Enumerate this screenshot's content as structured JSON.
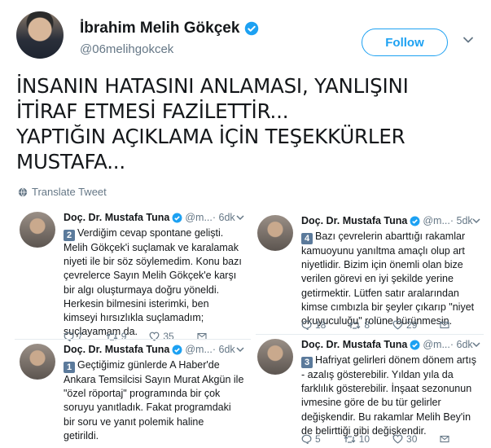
{
  "author": {
    "name": "İbrahim Melih Gökçek",
    "handle": "@06melihgokcek"
  },
  "follow_label": "Follow",
  "tweet_lines": [
    "İNSANIN HATASINI ANLAMASI, YANLIŞINI",
    "İTİRAF ETMESİ FAZİLETTİR...",
    "YAPTIĞIN AÇIKLAMA İÇİN TEŞEKKÜRLER",
    "MUSTAFA..."
  ],
  "translate_label": "Translate Tweet",
  "colors": {
    "accent": "#1da1f2",
    "secondary_text": "#657786",
    "divider": "#e6ecf0"
  },
  "embedded_tweets": [
    {
      "name": "Doç. Dr. Mustafa Tuna",
      "handle": "@m...",
      "time": "· 6dk",
      "badge": "2",
      "lines": [
        "Verdiğim cevap spontane gelişti.",
        "Melih Gökçek'i suçlamak ve karalamak",
        "niyeti ile bir söz söylemedim. Konu bazı",
        "çevrelerce Sayın Melih Gökçek'e karşı",
        "bir algı oluşturmaya doğru yöneldi.",
        "Herkesin bilmesini isterimki, ben",
        "kimseyi hırsızlıkla suçlamadım;",
        "suçlayamam da."
      ],
      "replies": "7",
      "retweets": "9",
      "likes": "35"
    },
    {
      "name": "Doç. Dr. Mustafa Tuna",
      "handle": "@m...",
      "time": "· 5dk",
      "badge": "4",
      "lines": [
        "Bazı çevrelerin abarttığı rakamlar",
        "kamuoyunu yanıltma amaçlı olup art",
        "niyetlidir. Bizim için önemli olan bize",
        "verilen görevi en iyi şekilde yerine",
        "getirmektir. Lütfen satır aralarından",
        "kimse cımbızla bir şeyler çıkarıp \"niyet",
        "okuyuculuğu\" rolüne bürünmesin."
      ],
      "replies": "18",
      "retweets": "8",
      "likes": "29"
    },
    {
      "name": "Doç. Dr. Mustafa Tuna",
      "handle": "@m...",
      "time": "· 6dk",
      "badge": "1",
      "lines": [
        "Geçtiğimiz günlerde A Haber'de",
        "Ankara Temsilcisi Sayın Murat Akgün ile",
        "\"özel röportaj\" programında bir çok",
        "soruyu yanıtladık. Fakat programdaki",
        "bir soru ve yanıt polemik haline",
        "getirildi."
      ]
    },
    {
      "name": "Doç. Dr. Mustafa Tuna",
      "handle": "@m...",
      "time": "· 6dk",
      "badge": "3",
      "lines": [
        "Hafriyat gelirleri dönem dönem artış",
        "- azalış gösterebilir. Yıldan yıla da",
        "farklılık gösterebilir. İnşaat sezonunun",
        "ivmesine göre de bu tür gelirler",
        "değişkendir. Bu rakamlar Melih Bey'in",
        "de belirttiği gibi değişkendir."
      ],
      "replies": "5",
      "retweets": "10",
      "likes": "30"
    }
  ]
}
